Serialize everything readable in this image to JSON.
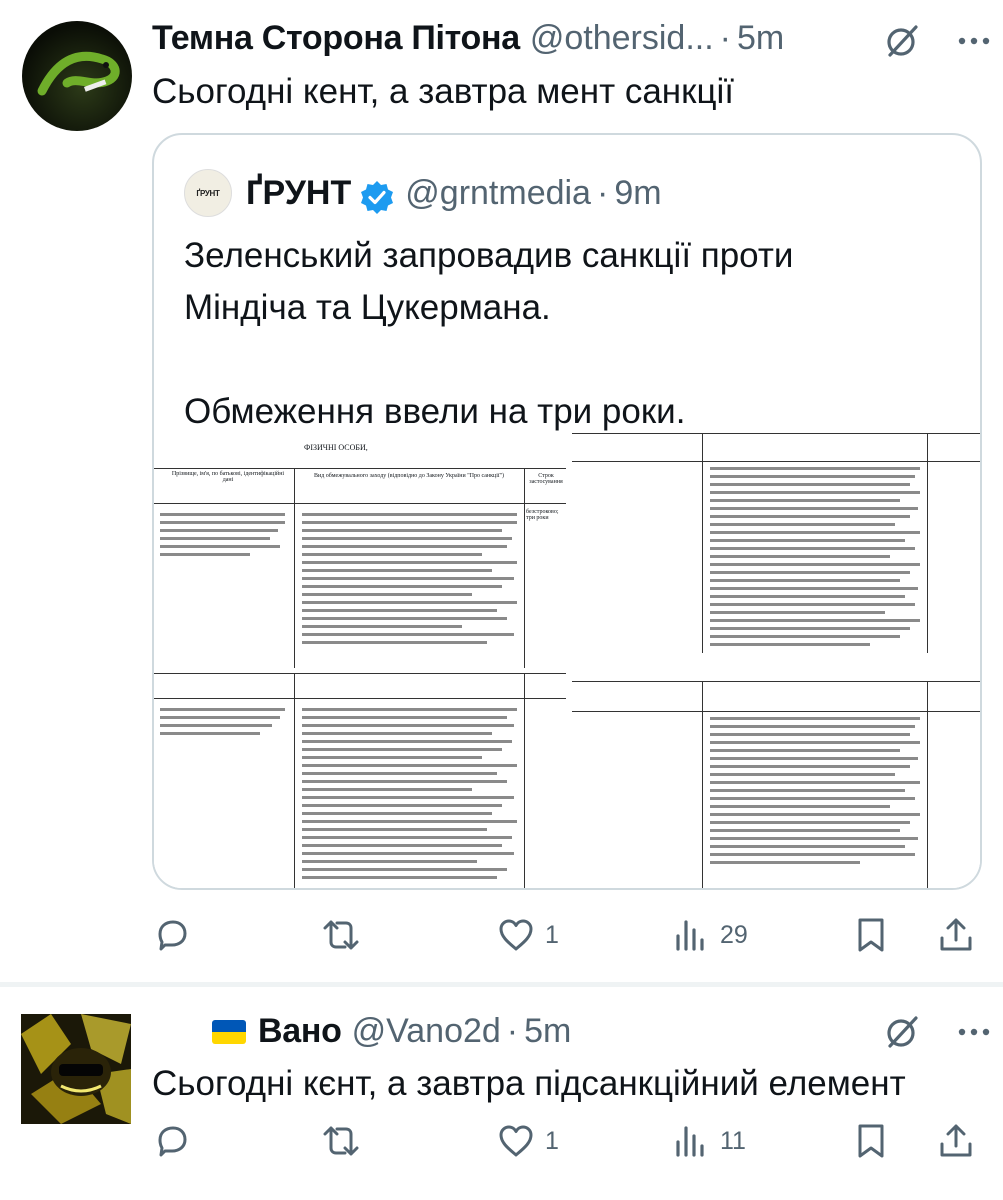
{
  "tweets": [
    {
      "name": "Темна Сторона Пітона",
      "handle": "@othersid...",
      "dot": "·",
      "time": "5m",
      "text": "Сьогодні кент, а завтра мент санкції",
      "replies": "",
      "retweets": "",
      "likes": "1",
      "views": "29",
      "quote": {
        "avatar_text": "ҐРУНТ",
        "name": "ҐРУНТ",
        "handle": "@grntmedia",
        "dot": "·",
        "time": "9m",
        "text_lines": [
          "Зеленський запровадив санкції проти",
          "Міндіча та Цукермана.",
          "",
          "Обмеження ввели на три роки."
        ],
        "doc_headers": {
          "title": "ФІЗИЧНІ ОСОБИ,",
          "col_name": "Прізвище, ім'я, по батькові, ідентифікаційні дані",
          "col_measure": "Вид обмежувального заходу (відповідно до Закону України \"Про санкції\")",
          "col_term": "Строк застосування",
          "term_value": "безстроково; три роки"
        }
      }
    },
    {
      "flag": "ukraine-flag",
      "name": "Вано",
      "handle": "@Vano2d",
      "dot": "·",
      "time": "5m",
      "text": "Сьогодні кєнт, а завтра підсанкційний елемент",
      "replies": "",
      "retweets": "",
      "likes": "1",
      "views": "11"
    }
  ],
  "colors": {
    "text": "#0f1419",
    "secondary": "#536471",
    "border": "#cfd9de",
    "verified": "#1d9bf0",
    "flag_blue": "#0057b7",
    "flag_yellow": "#ffd700"
  }
}
